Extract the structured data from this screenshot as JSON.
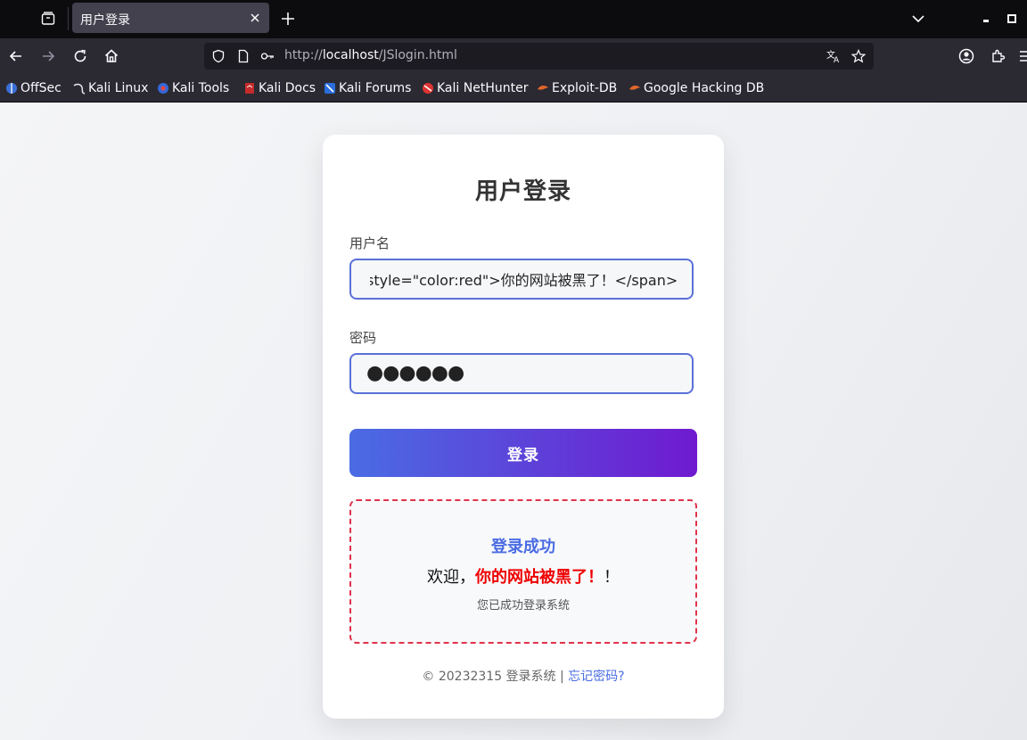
{
  "browser": {
    "tab_title": "用户登录",
    "url_scheme": "http://",
    "url_host": "localhost",
    "url_path": "/JSlogin.html",
    "bookmarks": [
      "OffSec",
      "Kali Linux",
      "Kali Tools",
      "Kali Docs",
      "Kali Forums",
      "Kali NetHunter",
      "Exploit-DB",
      "Google Hacking DB"
    ]
  },
  "login": {
    "title": "用户登录",
    "username_label": "用户名",
    "username_value": "style=\"color:red\">你的网站被黑了！</span>",
    "password_label": "密码",
    "password_mask": "●●●●●●",
    "submit_label": "登录"
  },
  "result": {
    "title": "登录成功",
    "welcome_prefix": "欢迎，",
    "welcome_injected": "你的网站被黑了！",
    "welcome_suffix": "！",
    "subtitle": "您已成功登录系统"
  },
  "footer": {
    "text": "© 20232315 登录系统 | ",
    "link": "忘记密码?"
  },
  "colors": {
    "accent": "#4a6ce3",
    "gradient_end": "#6f1ad0",
    "danger": "#ee0000"
  }
}
